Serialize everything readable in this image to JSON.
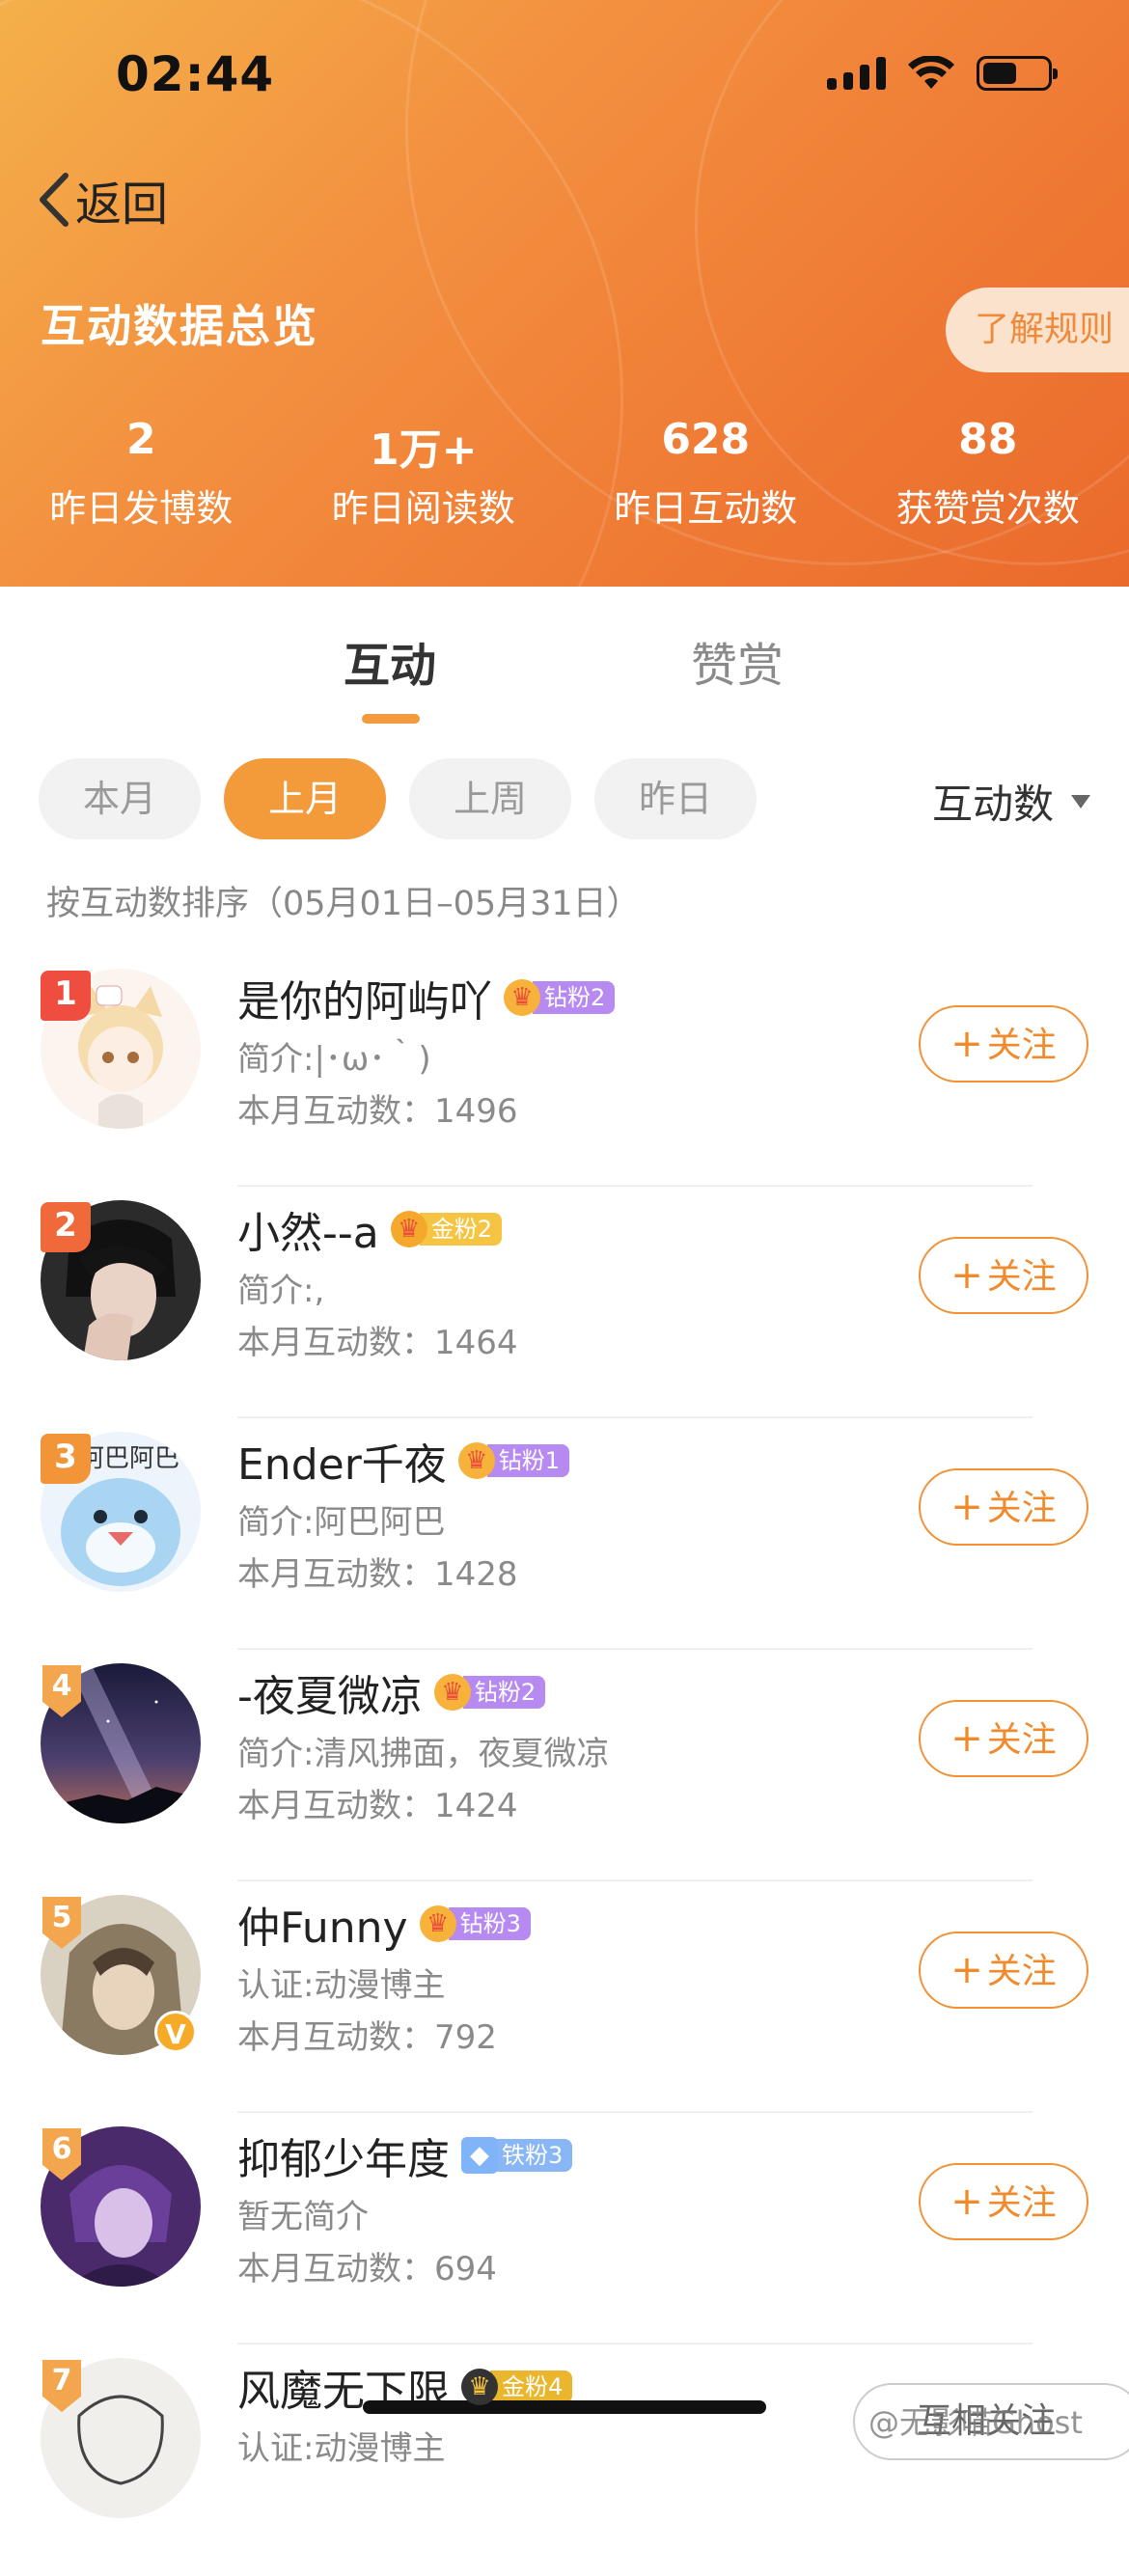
{
  "status_bar": {
    "time": "02:44"
  },
  "header": {
    "back_label": "返回",
    "title": "互动数据总览",
    "rules_button": "了解规则",
    "stats": [
      {
        "value": "2",
        "label": "昨日发博数"
      },
      {
        "value": "1万+",
        "label": "昨日阅读数"
      },
      {
        "value": "628",
        "label": "昨日互动数"
      },
      {
        "value": "88",
        "label": "获赞赏次数"
      }
    ]
  },
  "tabs": [
    {
      "label": "互动",
      "active": true
    },
    {
      "label": "赞赏",
      "active": false
    }
  ],
  "filters": {
    "chips": [
      {
        "label": "本月",
        "active": false
      },
      {
        "label": "上月",
        "active": true
      },
      {
        "label": "上周",
        "active": false
      },
      {
        "label": "昨日",
        "active": false
      }
    ],
    "sort_label": "互动数",
    "sort_note": "按互动数排序（05月01日–05月31日）"
  },
  "users": [
    {
      "rank": "1",
      "name": "是你的阿屿吖",
      "badge": "钻粉2",
      "badge_style": "purple",
      "intro": "简介:|･ω･｀)",
      "count": "本月互动数：1496",
      "follow": "关注"
    },
    {
      "rank": "2",
      "name": "小然--a",
      "badge": "金粉2",
      "badge_style": "gold",
      "intro": "简介:,",
      "count": "本月互动数：1464",
      "follow": "关注"
    },
    {
      "rank": "3",
      "name": "Ender千夜",
      "badge": "钻粉1",
      "badge_style": "purple",
      "intro": "简介:阿巴阿巴",
      "count": "本月互动数：1428",
      "follow": "关注"
    },
    {
      "rank": "4",
      "name": "-夜夏微凉",
      "badge": "钻粉2",
      "badge_style": "purple",
      "intro": "简介:清风拂面，夜夏微凉",
      "count": "本月互动数：1424",
      "follow": "关注"
    },
    {
      "rank": "5",
      "name": "仲Funny",
      "badge": "钻粉3",
      "badge_style": "purple",
      "intro": "认证:动漫博主",
      "count": "本月互动数：792",
      "follow": "关注",
      "verified": true
    },
    {
      "rank": "6",
      "name": "抑郁少年度",
      "badge": "铁粉3",
      "badge_style": "blue",
      "intro": "暂无简介",
      "count": "本月互动数：694",
      "follow": "关注"
    },
    {
      "rank": "7",
      "name": "风魔无下限",
      "badge": "金粉4",
      "badge_style": "darkgold",
      "intro": "认证:动漫博主",
      "count": "",
      "follow": "关注"
    }
  ],
  "floating": {
    "mutual_button": "互相关注",
    "watermark": "@无影喵Ghost"
  },
  "colors": {
    "accent": "#f29135",
    "header_start": "#f4b04a",
    "header_end": "#ea6a2c"
  }
}
